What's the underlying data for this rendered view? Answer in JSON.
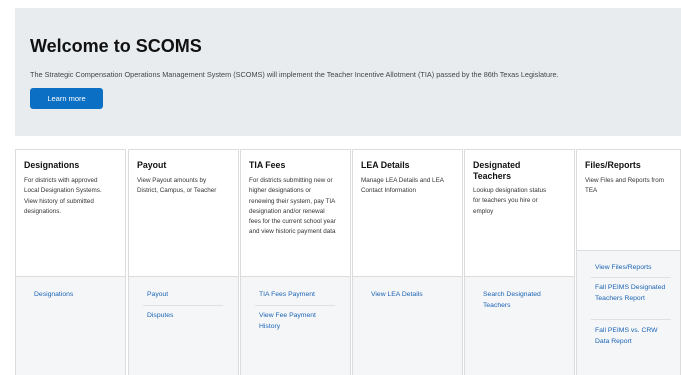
{
  "hero": {
    "title": "Welcome to SCOMS",
    "description": "The Strategic Compensation Operations Management System (SCOMS) will implement the Teacher Incentive Allotment (TIA) passed by the 86th Texas Legislature.",
    "button_label": "Learn more"
  },
  "cards": [
    {
      "title": "Designations",
      "description": "For districts with approved Local Designation Systems. View history of submitted designations.",
      "links": [
        "Designations"
      ]
    },
    {
      "title": "Payout",
      "description": "View Payout amounts by District, Campus, or Teacher",
      "links": [
        "Payout",
        "Disputes"
      ]
    },
    {
      "title": "TIA Fees",
      "description": "For districts submitting new or higher designations or renewing their system, pay TIA designation and/or renewal fees for the current school year and view historic payment data",
      "links": [
        "TIA Fees Payment",
        "View Fee Payment History"
      ]
    },
    {
      "title": "LEA Details",
      "description": "Manage LEA Details and LEA Contact Information",
      "links": [
        "View LEA Details"
      ]
    },
    {
      "title": "Designated Teachers",
      "description": "Lookup designation status for teachers you hire or employ",
      "links": [
        "Search Designated Teachers"
      ]
    },
    {
      "title": "Files/Reports",
      "description": "View Files and Reports from TEA",
      "links": [
        "View Files/Reports",
        "Fall PEIMS Designated Teachers Report",
        "Fall PEIMS vs. CRW Data Report"
      ]
    }
  ]
}
